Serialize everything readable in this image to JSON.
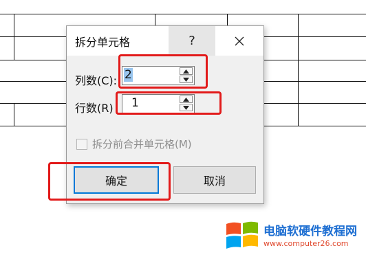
{
  "dialog": {
    "title": "拆分单元格",
    "help_label": "?",
    "columns": {
      "label": "列数(C):",
      "value": "2"
    },
    "rows": {
      "label": "行数(R)",
      "value": "1"
    },
    "merge_checkbox": {
      "label": "拆分前合并单元格(M)",
      "checked": false,
      "enabled": false
    },
    "ok_label": "确定",
    "cancel_label": "取消"
  },
  "watermark": {
    "site_name": "电脑软硬件教程网",
    "url": "www.computer26.com"
  },
  "colors": {
    "annotation": "#e21a1a",
    "focus_border": "#0078d7",
    "selection": "#99c5ee"
  }
}
